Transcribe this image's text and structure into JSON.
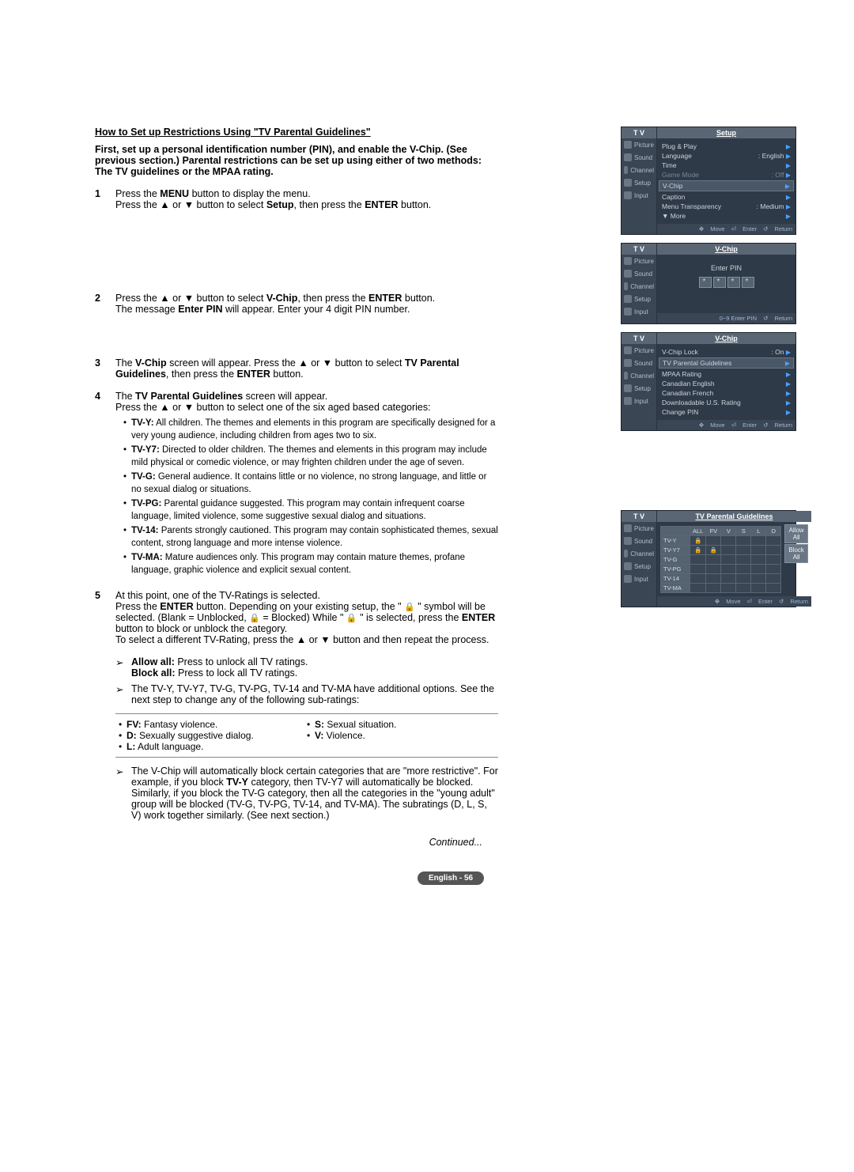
{
  "title": "How to Set up Restrictions Using \"TV Parental Guidelines\"",
  "intro": "First, set up a personal identification number (PIN), and enable the V-Chip. (See previous section.) Parental restrictions can be set up using either of two methods: The TV guidelines or the MPAA rating.",
  "steps": {
    "s1a": "Press the ",
    "s1b": "MENU",
    "s1c": " button to display the menu.",
    "s1d": "Press the ▲ or ▼ button to select ",
    "s1e": "Setup",
    "s1f": ", then press the ",
    "s1g": "ENTER",
    "s1h": " button.",
    "s2a": "Press the ▲ or ▼ button to select ",
    "s2b": "V-Chip",
    "s2c": ", then press the ",
    "s2d": "ENTER",
    "s2e": " button.",
    "s2f": "The message ",
    "s2g": "Enter PIN",
    "s2h": " will appear. Enter your 4 digit PIN number.",
    "s3a": "The ",
    "s3b": "V-Chip",
    "s3c": " screen will appear. Press the ▲ or ▼ button to select ",
    "s3d": "TV Parental Guidelines",
    "s3e": ", then press the ",
    "s3f": "ENTER",
    "s3g": " button.",
    "s4a": "The ",
    "s4b": "TV Parental Guidelines",
    "s4c": " screen will appear.",
    "s4d": "Press the ▲ or ▼ button to select one of the six aged based categories:",
    "s5a": "At this point, one of the TV-Ratings is selected.",
    "s5b": "Press the ",
    "s5c": "ENTER",
    "s5d": " button. Depending on your existing setup, the \" ",
    "s5e": " \" symbol will be selected. (Blank = Unblocked, ",
    "s5f": " = Blocked) While \" ",
    "s5g": " \" is selected, press the ",
    "s5h": "ENTER",
    "s5i": " button to block or unblock the category.",
    "s5j": "To select a different TV-Rating, press the ▲ or ▼ button and then repeat the process."
  },
  "ratings": [
    {
      "k": "TV-Y:",
      "v": " All children. The themes and elements in this program are specifically designed for a very young audience, including children from ages two to six."
    },
    {
      "k": "TV-Y7:",
      "v": " Directed to older children. The themes and elements in this program may include mild physical or comedic violence, or may frighten children under the age of seven."
    },
    {
      "k": "TV-G:",
      "v": " General audience. It contains little or no violence, no strong language, and little or no sexual dialog or situations."
    },
    {
      "k": "TV-PG:",
      "v": " Parental guidance suggested. This program may contain infrequent coarse language, limited violence, some suggestive sexual dialog and situations."
    },
    {
      "k": "TV-14:",
      "v": " Parents strongly cautioned. This program may contain sophisticated themes, sexual content, strong language and more intense violence."
    },
    {
      "k": "TV-MA:",
      "v": " Mature audiences only. This program may contain mature themes, profane language, graphic violence and explicit sexual content."
    }
  ],
  "arrows": {
    "a1a": "Allow all:",
    "a1b": " Press to unlock all TV ratings.",
    "a1c": "Block all:",
    "a1d": " Press to lock all TV ratings.",
    "a2": "The TV-Y, TV-Y7, TV-G, TV-PG, TV-14 and TV-MA have additional options. See the next step to change any of the following sub-ratings:",
    "a3": "The V-Chip will automatically block certain categories that are \"more restrictive\". For example, if you block ",
    "a3b": "TV-Y",
    "a3c": " category, then TV-Y7 will automatically be blocked. Similarly, if you block the TV-G category, then all the categories in the \"young adult\" group will be blocked (TV-G, TV-PG, TV-14, and TV-MA). The subratings (D, L, S, V) work together similarly. (See next section.)"
  },
  "subratings": [
    [
      {
        "k": "FV:",
        "v": " Fantasy violence."
      },
      {
        "k": "D:",
        "v": " Sexually suggestive dialog."
      },
      {
        "k": "L:",
        "v": " Adult language."
      }
    ],
    [
      {
        "k": "S:",
        "v": " Sexual situation."
      },
      {
        "k": "V:",
        "v": " Violence."
      }
    ]
  ],
  "continued": "Continued...",
  "footer": "English - 56",
  "osd": {
    "tv": "T V",
    "side": [
      "Picture",
      "Sound",
      "Channel",
      "Setup",
      "Input"
    ],
    "setup": {
      "title": "Setup",
      "items": [
        {
          "l": "Plug & Play",
          "r": ""
        },
        {
          "l": "Language",
          "r": ": English"
        },
        {
          "l": "Time",
          "r": ""
        },
        {
          "l": "Game Mode",
          "r": ": Off",
          "dim": true
        },
        {
          "l": "V-Chip",
          "r": "",
          "hl": true
        },
        {
          "l": "Caption",
          "r": ""
        },
        {
          "l": "Menu Transparency",
          "r": ": Medium"
        },
        {
          "l": "▼ More",
          "r": ""
        }
      ],
      "foot": {
        "move": "Move",
        "enter": "Enter",
        "ret": "Return"
      }
    },
    "pin": {
      "title": "V-Chip",
      "label": "Enter PIN",
      "foot": {
        "hint": "0~9 Enter PIN",
        "ret": "Return"
      }
    },
    "vchip": {
      "title": "V-Chip",
      "items": [
        {
          "l": "V-Chip Lock",
          "r": ": On"
        },
        {
          "l": "TV Parental Guidelines",
          "r": "",
          "hl": true
        },
        {
          "l": "MPAA Rating",
          "r": ""
        },
        {
          "l": "Canadian English",
          "r": ""
        },
        {
          "l": "Canadian French",
          "r": ""
        },
        {
          "l": "Downloadable U.S. Rating",
          "r": ""
        },
        {
          "l": "Change PIN",
          "r": ""
        }
      ],
      "foot": {
        "move": "Move",
        "enter": "Enter",
        "ret": "Return"
      }
    },
    "grid": {
      "title": "TV Parental Guidelines",
      "cols": [
        "ALL",
        "FV",
        "V",
        "S",
        "L",
        "D"
      ],
      "rows": [
        "TV-Y",
        "TV-Y7",
        "TV-G",
        "TV-PG",
        "TV-14",
        "TV-MA"
      ],
      "allow": "Allow All",
      "block": "Block All",
      "foot": {
        "move": "Move",
        "enter": "Enter",
        "ret": "Return"
      }
    }
  }
}
